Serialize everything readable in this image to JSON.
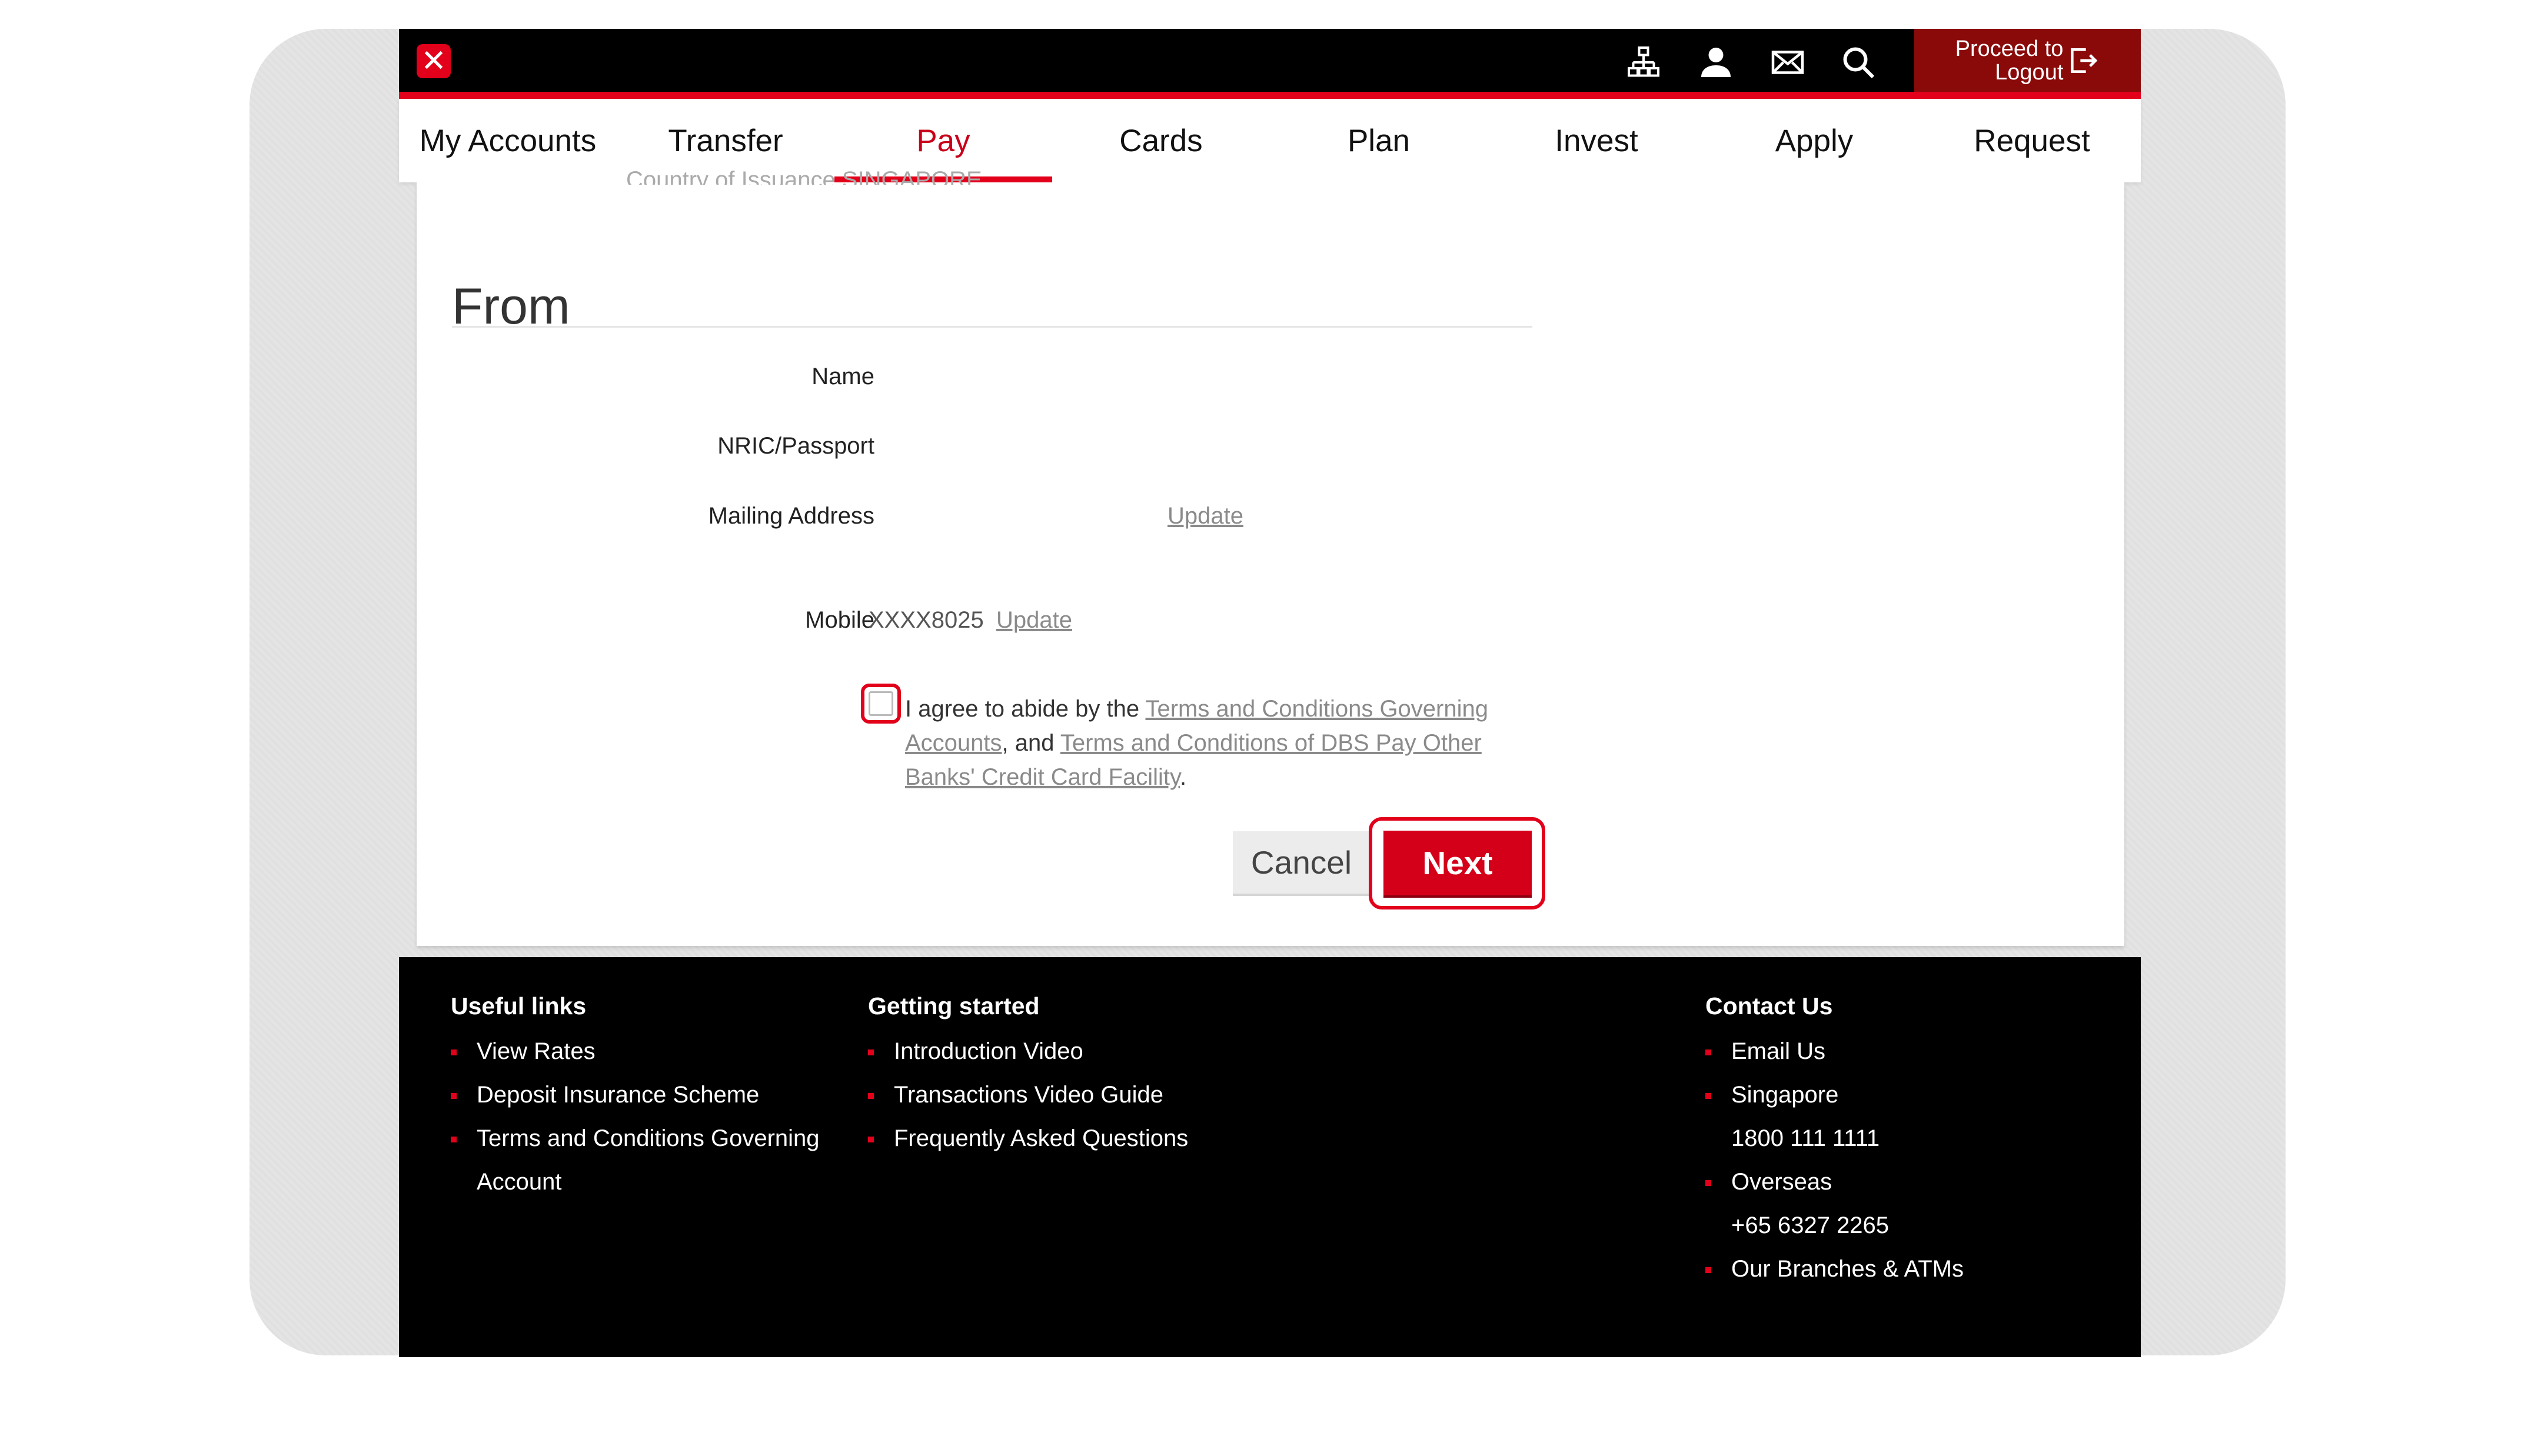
{
  "header": {
    "logout_label": "Proceed to\nLogout",
    "icons": [
      "sitemap-icon",
      "user-icon",
      "mail-icon",
      "search-icon",
      "logout-icon"
    ],
    "brand_color": "#e2001a"
  },
  "nav": {
    "items": [
      {
        "label": "My Accounts"
      },
      {
        "label": "Transfer"
      },
      {
        "label": "Pay"
      },
      {
        "label": "Cards"
      },
      {
        "label": "Plan"
      },
      {
        "label": "Invest"
      },
      {
        "label": "Apply"
      },
      {
        "label": "Request"
      }
    ],
    "active": "Pay"
  },
  "main": {
    "clipped_row": "Country of Issuance      SINGAPORE",
    "section_title": "From",
    "fields": {
      "name_label": "Name",
      "nric_label": "NRIC/Passport",
      "address_label": "Mailing Address",
      "address_update": "Update",
      "mobile_label": "Mobile",
      "mobile_value": "XXXX8025",
      "mobile_update": "Update"
    },
    "agreement": {
      "prefix": "I agree to abide by the ",
      "link1": "Terms and Conditions Governing Accounts",
      "middle": ", and ",
      "link2": "Terms and Conditions of DBS Pay Other Banks' Credit Card Facility",
      "suffix": "."
    },
    "cancel_label": "Cancel",
    "next_label": "Next"
  },
  "footer": {
    "useful_links": {
      "heading": "Useful links",
      "items": [
        "View Rates",
        "Deposit Insurance Scheme",
        "Terms and Conditions Governing Account"
      ]
    },
    "getting_started": {
      "heading": "Getting started",
      "items": [
        "Introduction Video",
        "Transactions Video Guide",
        "Frequently Asked Questions"
      ]
    },
    "contact": {
      "heading": "Contact Us",
      "email": "Email Us",
      "singapore_label": "Singapore",
      "singapore_phone": "1800 111 1111",
      "overseas_label": "Overseas",
      "overseas_phone": "+65 6327 2265",
      "branches": "Our Branches & ATMs"
    }
  }
}
